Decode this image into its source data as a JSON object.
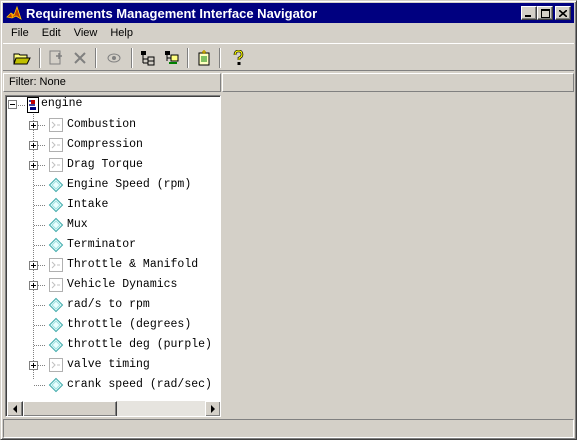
{
  "window": {
    "title": "Requirements Management Interface Navigator"
  },
  "menu": [
    {
      "label": "File"
    },
    {
      "label": "Edit"
    },
    {
      "label": "View"
    },
    {
      "label": "Help"
    }
  ],
  "toolbar": {
    "buttons": [
      {
        "icon": "open-folder-icon"
      },
      {
        "icon": "add-requirement-icon"
      },
      {
        "icon": "delete-icon"
      },
      {
        "icon": "view-icon"
      },
      {
        "icon": "expand-tree-icon"
      },
      {
        "icon": "collapse-tree-icon"
      },
      {
        "icon": "document-icon"
      },
      {
        "icon": "help-icon"
      }
    ]
  },
  "filter": {
    "label": "Filter: None"
  },
  "tree": {
    "root": {
      "label": "engine",
      "icon": "model-icon",
      "expanded": true
    },
    "children": [
      {
        "label": "Combustion",
        "icon": "subsystem-icon",
        "expandable": true
      },
      {
        "label": "Compression",
        "icon": "subsystem-icon",
        "expandable": true
      },
      {
        "label": "Drag Torque",
        "icon": "subsystem-icon",
        "expandable": true
      },
      {
        "label": "Engine Speed (rpm)",
        "icon": "block-icon",
        "expandable": false
      },
      {
        "label": "Intake",
        "icon": "block-icon",
        "expandable": false
      },
      {
        "label": "Mux",
        "icon": "block-icon",
        "expandable": false
      },
      {
        "label": "Terminator",
        "icon": "block-icon",
        "expandable": false
      },
      {
        "label": "Throttle & Manifold",
        "icon": "subsystem-icon",
        "expandable": true
      },
      {
        "label": "Vehicle Dynamics",
        "icon": "subsystem-icon",
        "expandable": true
      },
      {
        "label": "rad/s to rpm",
        "icon": "block-icon",
        "expandable": false
      },
      {
        "label": "throttle (degrees)",
        "icon": "block-icon",
        "expandable": false
      },
      {
        "label": "throttle deg (purple)",
        "icon": "block-icon",
        "expandable": false
      },
      {
        "label": "valve timing",
        "icon": "subsystem-icon",
        "expandable": true
      },
      {
        "label": "crank speed (rad/sec)",
        "icon": "block-icon",
        "expandable": false
      }
    ]
  },
  "colors": {
    "titlebar": "#000080",
    "face": "#d4d0c8",
    "block_icon": "#3ca8a8"
  }
}
